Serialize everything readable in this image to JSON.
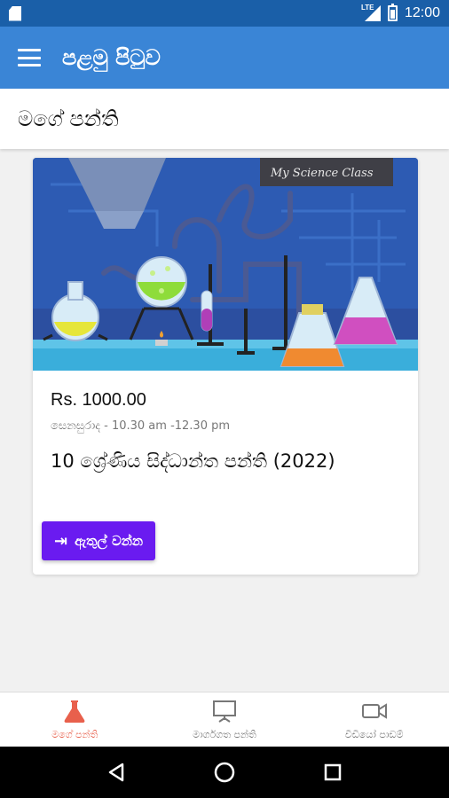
{
  "status_bar": {
    "time": "12:00",
    "network_label": "LTE",
    "icons": [
      "sd-card-icon",
      "signal-icon",
      "battery-icon"
    ]
  },
  "app_bar": {
    "title": "පළමු පිටුව",
    "menu_icon": "hamburger-menu-icon"
  },
  "section": {
    "title": "මගේ පන්ති"
  },
  "class_card": {
    "image_caption": "My Science Class",
    "price": "Rs. 1000.00",
    "schedule": "සෙනසුරාද - 10.30 am -12.30 pm",
    "title": "10 ශ්‍රේණිය සිද්ධාන්ත පන්ති (2022)",
    "enter_icon": "login-icon",
    "enter_label": "ඇතුල් වන්න"
  },
  "bottom_nav": {
    "items": [
      {
        "label": "මගේ පන්ති",
        "icon": "flask-icon",
        "active": true
      },
      {
        "label": "මාර්ගගත පන්ති",
        "icon": "presentation-board-icon",
        "active": false
      },
      {
        "label": "වීඩියෝ පාඩම්",
        "icon": "video-camera-icon",
        "active": false
      }
    ]
  },
  "colors": {
    "status_bar": "#1a5fa8",
    "app_bar": "#3a85d6",
    "accent_button": "#6a1bf0",
    "active_tab": "#e8604c",
    "background": "#f1f1f1"
  }
}
